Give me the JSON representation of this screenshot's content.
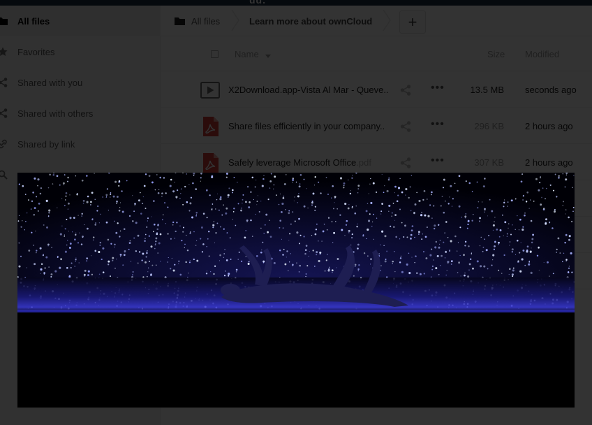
{
  "header": {
    "logo_text": "ud."
  },
  "sidebar": {
    "items": [
      {
        "label": "All files",
        "icon": "folder-icon",
        "active": true
      },
      {
        "label": "Favorites",
        "icon": "star-icon"
      },
      {
        "label": "Shared with you",
        "icon": "share-icon"
      },
      {
        "label": "Shared with others",
        "icon": "share-icon"
      },
      {
        "label": "Shared by link",
        "icon": "link-icon"
      }
    ]
  },
  "breadcrumb": {
    "root_label": "All files",
    "current_label": "Learn more about ownCloud"
  },
  "table": {
    "columns": {
      "name": "Name",
      "size": "Size",
      "modified": "Modified"
    },
    "rows": [
      {
        "name": "X2Download.app-Vista Al Mar - Queve..",
        "ext": "",
        "type": "video",
        "size": "13.5 MB",
        "modified": "seconds ago"
      },
      {
        "name": "Share files efficiently in your company..",
        "ext": "",
        "type": "pdf",
        "size": "296 KB",
        "modified": "2 hours ago"
      },
      {
        "name": "Safely leverage Microsoft Office",
        "ext": ".pdf",
        "type": "pdf",
        "size": "307 KB",
        "modified": "2 hours ago"
      }
    ]
  },
  "colors": {
    "header_bg": "#1d2d44",
    "pdf_red": "#d43f3a",
    "overlay": "rgba(0,0,0,0.80)"
  }
}
